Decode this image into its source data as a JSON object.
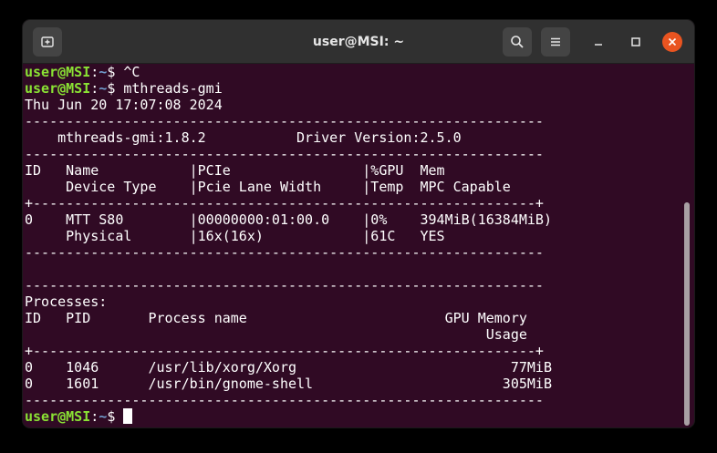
{
  "window": {
    "title": "user@MSI: ~"
  },
  "prompt": {
    "user_host": "user@MSI",
    "sep": ":",
    "path": "~",
    "symbol": "$ "
  },
  "lines": [
    {
      "type": "prompt",
      "cmd": "^C"
    },
    {
      "type": "prompt",
      "cmd": "mthreads-gmi"
    },
    {
      "type": "text",
      "text": "Thu Jun 20 17:07:08 2024"
    },
    {
      "type": "text",
      "text": "---------------------------------------------------------------"
    },
    {
      "type": "text",
      "text": "    mthreads-gmi:1.8.2           Driver Version:2.5.0"
    },
    {
      "type": "text",
      "text": "---------------------------------------------------------------"
    },
    {
      "type": "text",
      "text": "ID   Name           |PCIe                |%GPU  Mem"
    },
    {
      "type": "text",
      "text": "     Device Type    |Pcie Lane Width     |Temp  MPC Capable"
    },
    {
      "type": "text",
      "text": "+-------------------------------------------------------------+"
    },
    {
      "type": "text",
      "text": "0    MTT S80        |00000000:01:00.0    |0%    394MiB(16384MiB)"
    },
    {
      "type": "text",
      "text": "     Physical       |16x(16x)            |61C   YES"
    },
    {
      "type": "text",
      "text": "---------------------------------------------------------------"
    },
    {
      "type": "text",
      "text": ""
    },
    {
      "type": "text",
      "text": "---------------------------------------------------------------"
    },
    {
      "type": "text",
      "text": "Processes:"
    },
    {
      "type": "text",
      "text": "ID   PID       Process name                        GPU Memory"
    },
    {
      "type": "text",
      "text": "                                                        Usage"
    },
    {
      "type": "text",
      "text": "+-------------------------------------------------------------+"
    },
    {
      "type": "text",
      "text": "0    1046      /usr/lib/xorg/Xorg                          77MiB"
    },
    {
      "type": "text",
      "text": "0    1601      /usr/bin/gnome-shell                       305MiB"
    },
    {
      "type": "text",
      "text": "---------------------------------------------------------------"
    },
    {
      "type": "prompt",
      "cmd": "",
      "cursor": true
    }
  ],
  "icons": {
    "new_tab": "new-tab-icon",
    "search": "search-icon",
    "menu": "hamburger-menu-icon",
    "minimize": "minimize-icon",
    "maximize": "maximize-icon",
    "close": "close-icon"
  },
  "colors": {
    "terminal_bg": "#300a24",
    "prompt_user": "#8ae234",
    "prompt_path": "#729fcf",
    "close_button": "#e95420"
  }
}
